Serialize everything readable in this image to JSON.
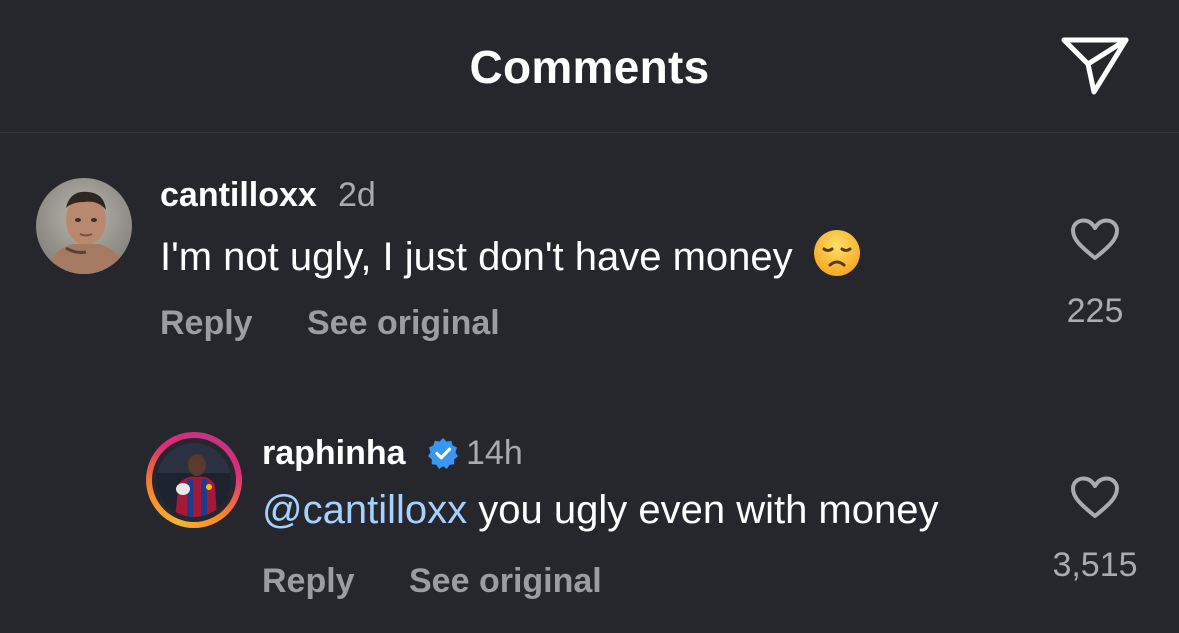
{
  "header": {
    "title": "Comments",
    "share_icon": "paper-plane-icon"
  },
  "comments": [
    {
      "username": "cantilloxx",
      "time": "2d",
      "text": "I'm not ugly, I just don't have money",
      "emoji": "😞",
      "reply_label": "Reply",
      "see_original_label": "See original",
      "likes": "225",
      "verified": false
    },
    {
      "username": "raphinha",
      "time": "14h",
      "mention": "@cantilloxx",
      "text": " you ugly even with money",
      "reply_label": "Reply",
      "see_original_label": "See original",
      "likes": "3,515",
      "verified": true,
      "verified_color": "#3897f0",
      "story_ring": true
    }
  ]
}
